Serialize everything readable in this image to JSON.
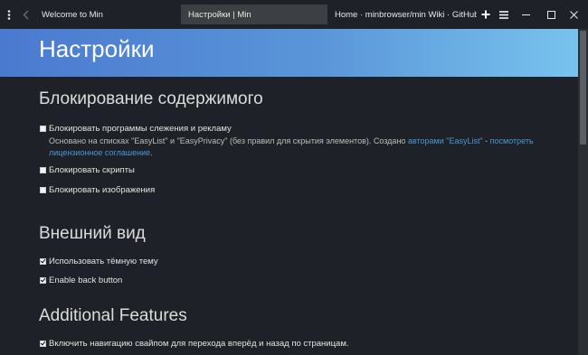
{
  "tabbar": {
    "tabs": [
      {
        "title": "Welcome to Min"
      },
      {
        "title": "Настройки | Min"
      },
      {
        "title": "Home · minbrowser/min Wiki · GitHub"
      }
    ],
    "icons": {
      "menu": "vertical-dots-icon",
      "back": "arrow-left-icon",
      "new_tab": "plus-icon",
      "tasks": "hamburger-icon",
      "minimize": "minimize-icon",
      "maximize": "maximize-icon",
      "close": "close-icon"
    }
  },
  "page": {
    "title": "Настройки",
    "sections": [
      {
        "heading": "Блокирование содержимого",
        "options": [
          {
            "label": "Блокировать программы слежения и рекламу",
            "checked": false,
            "description": {
              "text": "Основано на списках \"EasyList\" и \"EasyPrivacy\" (без правил для скрытия элементов). Создано ",
              "link1": "авторами \"EasyList\"",
              "separator": " - ",
              "link2": "посмотреть лицензионное соглашение",
              "end": "."
            }
          },
          {
            "label": "Блокировать скрипты",
            "checked": false
          },
          {
            "label": "Блокировать изображения",
            "checked": false
          }
        ]
      },
      {
        "heading": "Внешний вид",
        "options": [
          {
            "label": "Использовать тёмную тему",
            "checked": true
          },
          {
            "label": "Enable back button",
            "checked": true
          }
        ]
      },
      {
        "heading": "Additional Features",
        "options": [
          {
            "label": "Включить навигацию свайпом для перехода вперёд и назад по страницам.",
            "checked": true
          }
        ]
      }
    ]
  },
  "colors": {
    "background": "#1e2127",
    "active_tab": "#3c3f44",
    "banner_start": "#4a7ad0",
    "banner_end": "#78c3ee",
    "link": "#4a98d8"
  }
}
